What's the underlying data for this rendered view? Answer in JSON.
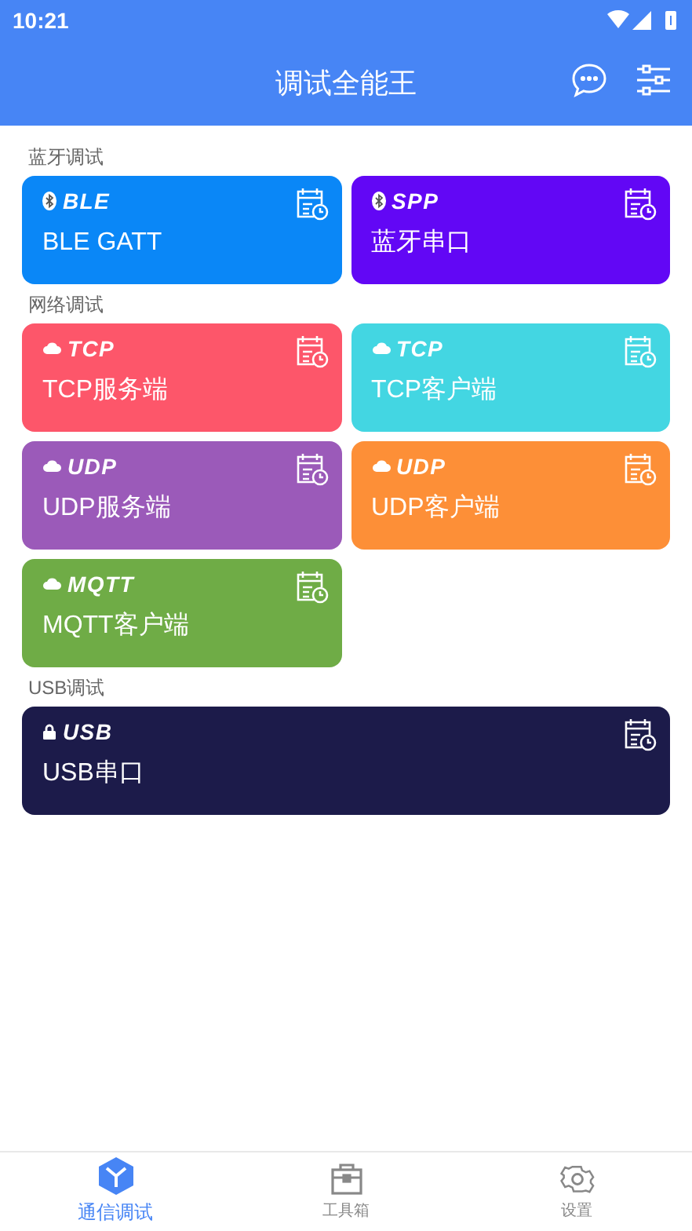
{
  "status_bar": {
    "time": "10:21"
  },
  "header": {
    "title": "调试全能王"
  },
  "sections": [
    {
      "title": "蓝牙调试",
      "cards": [
        {
          "tag": "BLE",
          "kind": "bluetooth",
          "label": "BLE GATT",
          "color": "#0a87f7"
        },
        {
          "tag": "SPP",
          "kind": "bluetooth",
          "label": "蓝牙串口",
          "color": "#6207f5"
        }
      ]
    },
    {
      "title": "网络调试",
      "cards": [
        {
          "tag": "TCP",
          "kind": "network",
          "label": "TCP服务端",
          "color": "#fd566a"
        },
        {
          "tag": "TCP",
          "kind": "network",
          "label": "TCP客户端",
          "color": "#43d6e2"
        },
        {
          "tag": "UDP",
          "kind": "network",
          "label": "UDP服务端",
          "color": "#9b5ab9"
        },
        {
          "tag": "UDP",
          "kind": "network",
          "label": "UDP客户端",
          "color": "#fd8f37"
        },
        {
          "tag": "MQTT",
          "kind": "network",
          "label": "MQTT客户端",
          "color": "#6fac46"
        }
      ]
    },
    {
      "title": "USB调试",
      "cards": [
        {
          "tag": "USB",
          "kind": "usb",
          "label": "USB串口",
          "color": "#1c1b4a"
        }
      ]
    }
  ],
  "bottom_nav": [
    {
      "label": "通信调试",
      "selected": true
    },
    {
      "label": "工具箱",
      "selected": false
    },
    {
      "label": "设置",
      "selected": false
    }
  ]
}
